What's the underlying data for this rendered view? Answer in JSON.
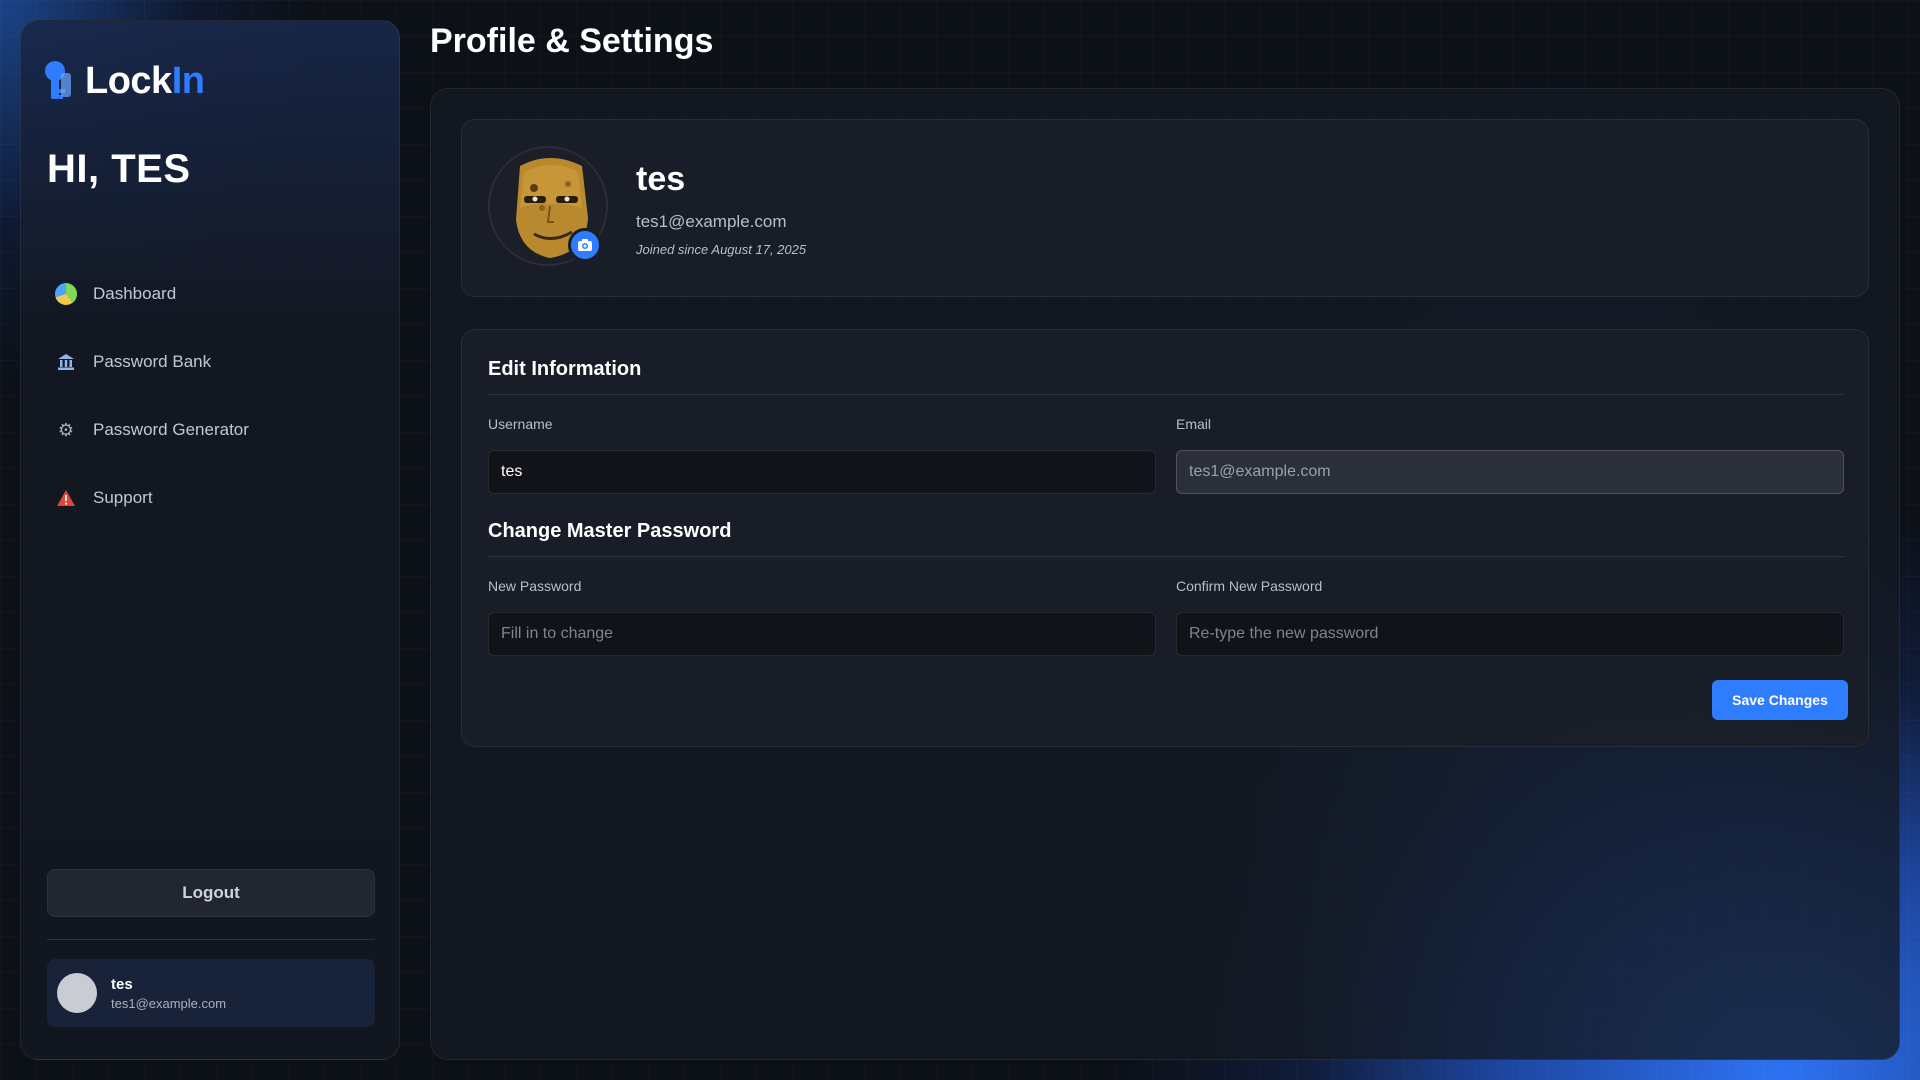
{
  "brand": {
    "name_main": "Lock",
    "name_accent": "In"
  },
  "sidebar": {
    "greeting": "HI, TES",
    "items": [
      {
        "label": "Dashboard",
        "icon": "dashboard-icon"
      },
      {
        "label": "Password Bank",
        "icon": "bank-icon"
      },
      {
        "label": "Password Generator",
        "icon": "gear-icon"
      },
      {
        "label": "Support",
        "icon": "warning-icon"
      }
    ],
    "logout_label": "Logout",
    "user": {
      "name": "tes",
      "email": "tes1@example.com"
    }
  },
  "main": {
    "title": "Profile & Settings",
    "profile": {
      "name": "tes",
      "email": "tes1@example.com",
      "joined": "Joined since August 17, 2025"
    },
    "edit": {
      "section_title": "Edit Information",
      "username_label": "Username",
      "username_value": "tes",
      "email_label": "Email",
      "email_value": "tes1@example.com",
      "password_section_title": "Change Master Password",
      "new_password_label": "New Password",
      "new_password_placeholder": "Fill in to change",
      "confirm_password_label": "Confirm New Password",
      "confirm_password_placeholder": "Re-type the new password",
      "save_label": "Save Changes"
    }
  },
  "colors": {
    "accent": "#2f7dff",
    "background": "#0c1017",
    "panel": "#151922"
  }
}
